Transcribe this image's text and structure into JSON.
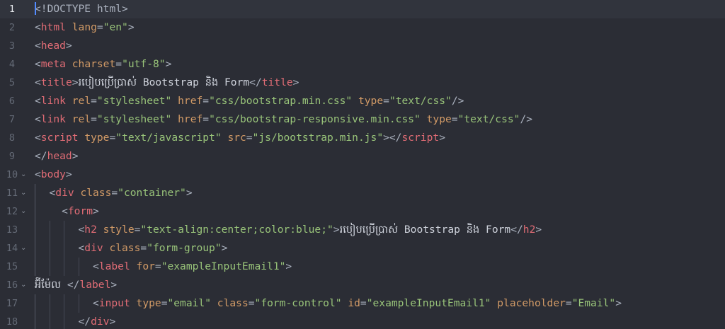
{
  "editor": {
    "lines": [
      {
        "n": "1",
        "indent": 0,
        "fold": "",
        "active": true,
        "cursor": true,
        "tokens": [
          {
            "t": "<",
            "c": "punct"
          },
          {
            "t": "!DOCTYPE html",
            "c": "dt"
          },
          {
            "t": ">",
            "c": "punct"
          }
        ]
      },
      {
        "n": "2",
        "indent": 0,
        "fold": "",
        "tokens": [
          {
            "t": "<",
            "c": "punct"
          },
          {
            "t": "html",
            "c": "tag"
          },
          {
            "t": " ",
            "c": "text"
          },
          {
            "t": "lang",
            "c": "attr"
          },
          {
            "t": "=",
            "c": "eq"
          },
          {
            "t": "\"en\"",
            "c": "str"
          },
          {
            "t": ">",
            "c": "punct"
          }
        ]
      },
      {
        "n": "3",
        "indent": 0,
        "fold": "",
        "tokens": [
          {
            "t": "<",
            "c": "punct"
          },
          {
            "t": "head",
            "c": "tag"
          },
          {
            "t": ">",
            "c": "punct"
          }
        ]
      },
      {
        "n": "4",
        "indent": 0,
        "fold": "",
        "tokens": [
          {
            "t": "<",
            "c": "punct"
          },
          {
            "t": "meta",
            "c": "tag"
          },
          {
            "t": " ",
            "c": "text"
          },
          {
            "t": "charset",
            "c": "attr"
          },
          {
            "t": "=",
            "c": "eq"
          },
          {
            "t": "\"utf-8\"",
            "c": "str"
          },
          {
            "t": ">",
            "c": "punct"
          }
        ]
      },
      {
        "n": "5",
        "indent": 0,
        "fold": "",
        "tokens": [
          {
            "t": "<",
            "c": "punct"
          },
          {
            "t": "title",
            "c": "tag"
          },
          {
            "t": ">",
            "c": "punct"
          },
          {
            "t": "របៀបប្រើប្រាស់ Bootstrap និង Form",
            "c": "text"
          },
          {
            "t": "</",
            "c": "punct"
          },
          {
            "t": "title",
            "c": "tag"
          },
          {
            "t": ">",
            "c": "punct"
          }
        ]
      },
      {
        "n": "6",
        "indent": 0,
        "fold": "",
        "tokens": [
          {
            "t": "<",
            "c": "punct"
          },
          {
            "t": "link",
            "c": "tag"
          },
          {
            "t": " ",
            "c": "text"
          },
          {
            "t": "rel",
            "c": "attr"
          },
          {
            "t": "=",
            "c": "eq"
          },
          {
            "t": "\"stylesheet\"",
            "c": "str"
          },
          {
            "t": " ",
            "c": "text"
          },
          {
            "t": "href",
            "c": "attr"
          },
          {
            "t": "=",
            "c": "eq"
          },
          {
            "t": "\"css/bootstrap.min.css\"",
            "c": "str"
          },
          {
            "t": " ",
            "c": "text"
          },
          {
            "t": "type",
            "c": "attr"
          },
          {
            "t": "=",
            "c": "eq"
          },
          {
            "t": "\"text/css\"",
            "c": "str"
          },
          {
            "t": "/>",
            "c": "punct"
          }
        ]
      },
      {
        "n": "7",
        "indent": 0,
        "fold": "",
        "tokens": [
          {
            "t": "<",
            "c": "punct"
          },
          {
            "t": "link",
            "c": "tag"
          },
          {
            "t": " ",
            "c": "text"
          },
          {
            "t": "rel",
            "c": "attr"
          },
          {
            "t": "=",
            "c": "eq"
          },
          {
            "t": "\"stylesheet\"",
            "c": "str"
          },
          {
            "t": " ",
            "c": "text"
          },
          {
            "t": "href",
            "c": "attr"
          },
          {
            "t": "=",
            "c": "eq"
          },
          {
            "t": "\"css/bootstrap-responsive.min.css\"",
            "c": "str"
          },
          {
            "t": " ",
            "c": "text"
          },
          {
            "t": "type",
            "c": "attr"
          },
          {
            "t": "=",
            "c": "eq"
          },
          {
            "t": "\"text/css\"",
            "c": "str"
          },
          {
            "t": "/>",
            "c": "punct"
          }
        ]
      },
      {
        "n": "8",
        "indent": 0,
        "fold": "",
        "tokens": [
          {
            "t": "<",
            "c": "punct"
          },
          {
            "t": "script",
            "c": "tag"
          },
          {
            "t": " ",
            "c": "text"
          },
          {
            "t": "type",
            "c": "attr"
          },
          {
            "t": "=",
            "c": "eq"
          },
          {
            "t": "\"text/javascript\"",
            "c": "str"
          },
          {
            "t": " ",
            "c": "text"
          },
          {
            "t": "src",
            "c": "attr"
          },
          {
            "t": "=",
            "c": "eq"
          },
          {
            "t": "\"js/bootstrap.min.js\"",
            "c": "str"
          },
          {
            "t": "></",
            "c": "punct"
          },
          {
            "t": "script",
            "c": "tag"
          },
          {
            "t": ">",
            "c": "punct"
          }
        ]
      },
      {
        "n": "9",
        "indent": 0,
        "fold": "",
        "tokens": [
          {
            "t": "</",
            "c": "punct"
          },
          {
            "t": "head",
            "c": "tag"
          },
          {
            "t": ">",
            "c": "punct"
          }
        ]
      },
      {
        "n": "10",
        "indent": 0,
        "fold": "v",
        "tokens": [
          {
            "t": "<",
            "c": "punct"
          },
          {
            "t": "body",
            "c": "tag"
          },
          {
            "t": ">",
            "c": "punct"
          }
        ]
      },
      {
        "n": "11",
        "indent": 1,
        "fold": "v",
        "tokens": [
          {
            "t": "<",
            "c": "punct"
          },
          {
            "t": "div",
            "c": "tag"
          },
          {
            "t": " ",
            "c": "text"
          },
          {
            "t": "class",
            "c": "attr"
          },
          {
            "t": "=",
            "c": "eq"
          },
          {
            "t": "\"container\"",
            "c": "str"
          },
          {
            "t": ">",
            "c": "punct"
          }
        ]
      },
      {
        "n": "12",
        "indent": 1,
        "fold": "v",
        "pad": "  ",
        "tokens": [
          {
            "t": "<",
            "c": "punct"
          },
          {
            "t": "form",
            "c": "tag"
          },
          {
            "t": ">",
            "c": "punct"
          }
        ]
      },
      {
        "n": "13",
        "indent": 3,
        "fold": "",
        "tokens": [
          {
            "t": "<",
            "c": "punct"
          },
          {
            "t": "h2",
            "c": "tag"
          },
          {
            "t": " ",
            "c": "text"
          },
          {
            "t": "style",
            "c": "attr"
          },
          {
            "t": "=",
            "c": "eq"
          },
          {
            "t": "\"text-align:center;color:blue;\"",
            "c": "str"
          },
          {
            "t": ">",
            "c": "punct"
          },
          {
            "t": "របៀបប្រើប្រាស់ Bootstrap និង Form",
            "c": "text"
          },
          {
            "t": "</",
            "c": "punct"
          },
          {
            "t": "h2",
            "c": "tag"
          },
          {
            "t": ">",
            "c": "punct"
          }
        ]
      },
      {
        "n": "14",
        "indent": 3,
        "fold": "v",
        "tokens": [
          {
            "t": "<",
            "c": "punct"
          },
          {
            "t": "div",
            "c": "tag"
          },
          {
            "t": " ",
            "c": "text"
          },
          {
            "t": "class",
            "c": "attr"
          },
          {
            "t": "=",
            "c": "eq"
          },
          {
            "t": "\"form-group\"",
            "c": "str"
          },
          {
            "t": ">",
            "c": "punct"
          }
        ]
      },
      {
        "n": "15",
        "indent": 4,
        "fold": "",
        "tokens": [
          {
            "t": "<",
            "c": "punct"
          },
          {
            "t": "label",
            "c": "tag"
          },
          {
            "t": " ",
            "c": "text"
          },
          {
            "t": "for",
            "c": "attr"
          },
          {
            "t": "=",
            "c": "eq"
          },
          {
            "t": "\"exampleInputEmail1\"",
            "c": "str"
          },
          {
            "t": ">",
            "c": "punct"
          }
        ]
      },
      {
        "n": "16",
        "indent": 0,
        "fold": "v",
        "tokens": [
          {
            "t": "អ៊ីម៉ែល ",
            "c": "text"
          },
          {
            "t": "</",
            "c": "punct"
          },
          {
            "t": "label",
            "c": "tag"
          },
          {
            "t": ">",
            "c": "punct"
          }
        ]
      },
      {
        "n": "17",
        "indent": 4,
        "fold": "",
        "tokens": [
          {
            "t": "<",
            "c": "punct"
          },
          {
            "t": "input",
            "c": "tag"
          },
          {
            "t": " ",
            "c": "text"
          },
          {
            "t": "type",
            "c": "attr"
          },
          {
            "t": "=",
            "c": "eq"
          },
          {
            "t": "\"email\"",
            "c": "str"
          },
          {
            "t": " ",
            "c": "text"
          },
          {
            "t": "class",
            "c": "attr"
          },
          {
            "t": "=",
            "c": "eq"
          },
          {
            "t": "\"form-control\"",
            "c": "str"
          },
          {
            "t": " ",
            "c": "text"
          },
          {
            "t": "id",
            "c": "attr"
          },
          {
            "t": "=",
            "c": "eq"
          },
          {
            "t": "\"exampleInputEmail1\"",
            "c": "str"
          },
          {
            "t": " ",
            "c": "text"
          },
          {
            "t": "placeholder",
            "c": "attr"
          },
          {
            "t": "=",
            "c": "eq"
          },
          {
            "t": "\"Email\"",
            "c": "str"
          },
          {
            "t": ">",
            "c": "punct"
          }
        ]
      },
      {
        "n": "18",
        "indent": 3,
        "fold": "",
        "tokens": [
          {
            "t": "</",
            "c": "punct"
          },
          {
            "t": "div",
            "c": "tag"
          },
          {
            "t": ">",
            "c": "punct"
          }
        ]
      }
    ]
  },
  "colors": {
    "background": "#2b2d35",
    "active_line": "#31343d",
    "tag": "#e06c75",
    "attribute": "#d19a66",
    "string": "#98c379",
    "text": "#cfd3dc",
    "cursor": "#528bff"
  },
  "icons": {
    "fold": "chevron-down-icon"
  }
}
